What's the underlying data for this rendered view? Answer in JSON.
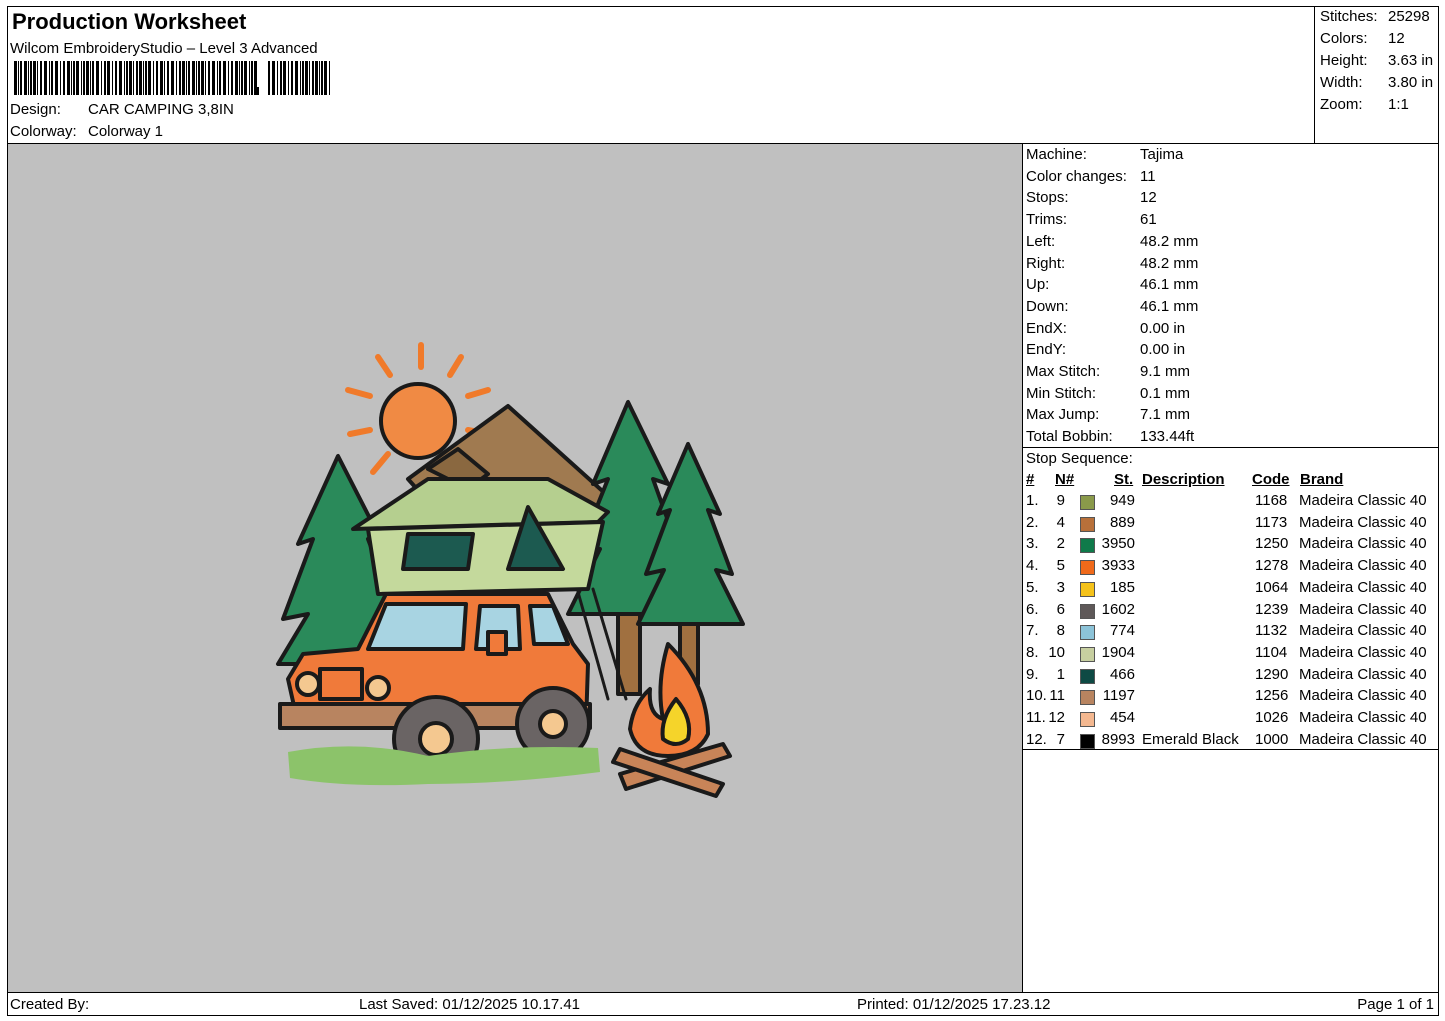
{
  "header": {
    "title": "Production Worksheet",
    "subtitle": "Wilcom EmbroideryStudio – Level 3 Advanced",
    "design_label": "Design:",
    "design_value": "CAR CAMPING 3,8IN",
    "colorway_label": "Colorway:",
    "colorway_value": "Colorway 1"
  },
  "stats": [
    {
      "label": "Stitches:",
      "value": "25298"
    },
    {
      "label": "Colors:",
      "value": "12"
    },
    {
      "label": "Height:",
      "value": "3.63 in"
    },
    {
      "label": "Width:",
      "value": "3.80 in"
    },
    {
      "label": "Zoom:",
      "value": "1:1"
    }
  ],
  "machine_info": [
    {
      "label": "Machine:",
      "value": "Tajima"
    },
    {
      "label": "Color changes:",
      "value": "11"
    },
    {
      "label": "Stops:",
      "value": "12"
    },
    {
      "label": "Trims:",
      "value": "61"
    },
    {
      "label": "Left:",
      "value": "48.2 mm"
    },
    {
      "label": "Right:",
      "value": "48.2 mm"
    },
    {
      "label": "Up:",
      "value": "46.1 mm"
    },
    {
      "label": "Down:",
      "value": "46.1 mm"
    },
    {
      "label": "EndX:",
      "value": "0.00 in"
    },
    {
      "label": "EndY:",
      "value": "0.00 in"
    },
    {
      "label": "Max Stitch:",
      "value": "9.1 mm"
    },
    {
      "label": "Min Stitch:",
      "value": "0.1 mm"
    },
    {
      "label": "Max Jump:",
      "value": "7.1 mm"
    },
    {
      "label": "Total Bobbin:",
      "value": "133.44ft"
    }
  ],
  "stop_sequence": {
    "label": "Stop Sequence:",
    "headers": {
      "idx": "#",
      "needle": "N#",
      "st": "St.",
      "desc": "Description",
      "code": "Code",
      "brand": "Brand"
    },
    "rows": [
      {
        "idx": "1.",
        "needle": "9",
        "color": "#8a9a4a",
        "st": "949",
        "desc": "",
        "code": "1168",
        "brand": "Madeira Classic 40"
      },
      {
        "idx": "2.",
        "needle": "4",
        "color": "#b8703a",
        "st": "889",
        "desc": "",
        "code": "1173",
        "brand": "Madeira Classic 40"
      },
      {
        "idx": "3.",
        "needle": "2",
        "color": "#0f7a4a",
        "st": "3950",
        "desc": "",
        "code": "1250",
        "brand": "Madeira Classic 40"
      },
      {
        "idx": "4.",
        "needle": "5",
        "color": "#f06a1a",
        "st": "3933",
        "desc": "",
        "code": "1278",
        "brand": "Madeira Classic 40"
      },
      {
        "idx": "5.",
        "needle": "3",
        "color": "#f5c21a",
        "st": "185",
        "desc": "",
        "code": "1064",
        "brand": "Madeira Classic 40"
      },
      {
        "idx": "6.",
        "needle": "6",
        "color": "#5e5858",
        "st": "1602",
        "desc": "",
        "code": "1239",
        "brand": "Madeira Classic 40"
      },
      {
        "idx": "7.",
        "needle": "8",
        "color": "#8cc3d8",
        "st": "774",
        "desc": "",
        "code": "1132",
        "brand": "Madeira Classic 40"
      },
      {
        "idx": "8.",
        "needle": "10",
        "color": "#c7cfa0",
        "st": "1904",
        "desc": "",
        "code": "1104",
        "brand": "Madeira Classic 40"
      },
      {
        "idx": "9.",
        "needle": "1",
        "color": "#0e4a44",
        "st": "466",
        "desc": "",
        "code": "1290",
        "brand": "Madeira Classic 40"
      },
      {
        "idx": "10.",
        "needle": "11",
        "color": "#b88460",
        "st": "1197",
        "desc": "",
        "code": "1256",
        "brand": "Madeira Classic 40"
      },
      {
        "idx": "11.",
        "needle": "12",
        "color": "#f4b890",
        "st": "454",
        "desc": "",
        "code": "1026",
        "brand": "Madeira Classic 40"
      },
      {
        "idx": "12.",
        "needle": "7",
        "color": "#000000",
        "st": "8993",
        "desc": "Emerald Black",
        "code": "1000",
        "brand": "Madeira Classic 40"
      }
    ]
  },
  "footer": {
    "created_by": "Created By:",
    "last_saved": "Last Saved: 01/12/2025 10.17.41",
    "printed": "Printed: 01/12/2025 17.23.12",
    "page": "Page 1 of 1"
  }
}
